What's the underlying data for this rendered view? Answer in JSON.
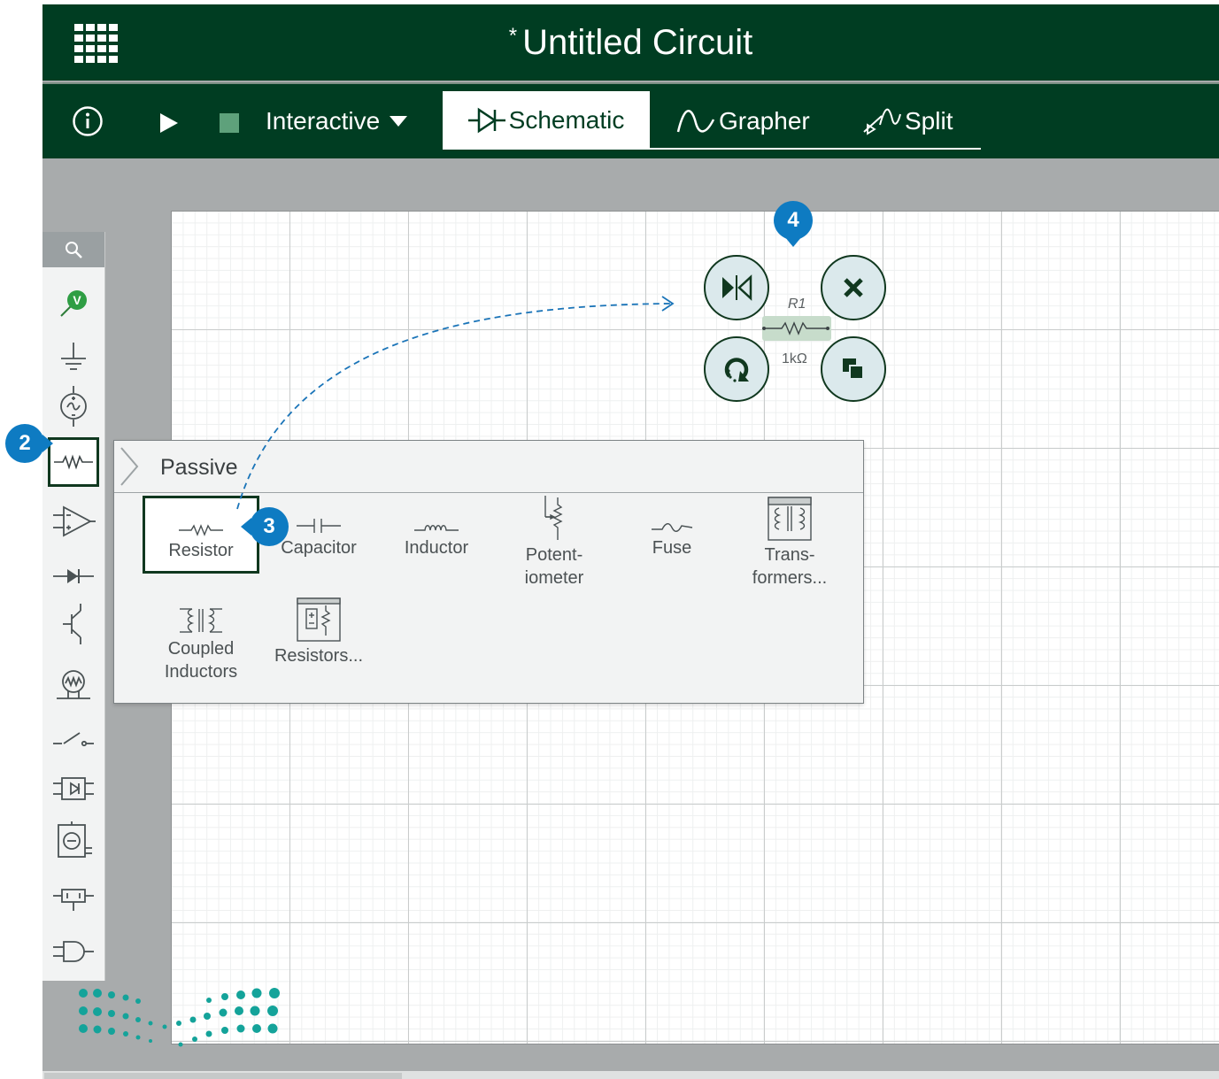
{
  "window": {
    "title_marker": "*",
    "title": "Untitled Circuit"
  },
  "toolbar": {
    "mode_label": "Interactive",
    "tabs": [
      {
        "label": "Schematic",
        "active": true
      },
      {
        "label": "Grapher",
        "active": false
      },
      {
        "label": "Split",
        "active": false
      }
    ]
  },
  "palette": {
    "icons": [
      "search-icon",
      "voltmeter-probe-icon",
      "ground-icon",
      "ac-source-icon",
      "resistor-category-icon",
      "op-amp-icon",
      "diode-icon",
      "transistor-icon",
      "lamp-icon",
      "switch-icon",
      "relay-icon",
      "motor-icon",
      "connector-icon",
      "logic-gate-icon"
    ],
    "probe_letter": "V"
  },
  "flyout": {
    "title": "Passive",
    "items": [
      {
        "line1": "Resistor",
        "line2": "",
        "icon": "resistor-icon",
        "selected": true
      },
      {
        "line1": "Capacitor",
        "line2": "",
        "icon": "capacitor-icon",
        "selected": false
      },
      {
        "line1": "Inductor",
        "line2": "",
        "icon": "inductor-icon",
        "selected": false
      },
      {
        "line1": "Potent-",
        "line2": "iometer",
        "icon": "potentiometer-icon",
        "selected": false
      },
      {
        "line1": "Fuse",
        "line2": "",
        "icon": "fuse-icon",
        "selected": false
      },
      {
        "line1": "Trans-",
        "line2": "formers...",
        "icon": "transformer-icon",
        "selected": false
      },
      {
        "line1": "Coupled",
        "line2": "Inductors",
        "icon": "coupled-inductors-icon",
        "selected": false
      },
      {
        "line1": "Resistors...",
        "line2": "",
        "icon": "resistor-network-icon",
        "selected": false
      }
    ]
  },
  "component": {
    "name": "R1",
    "value": "1kΩ"
  },
  "callouts": {
    "palette": "2",
    "resistor": "3",
    "placed": "4"
  },
  "colors": {
    "header_bg": "#003d22",
    "badge": "#0e7bc2",
    "action_button": "#dbe9ec"
  }
}
